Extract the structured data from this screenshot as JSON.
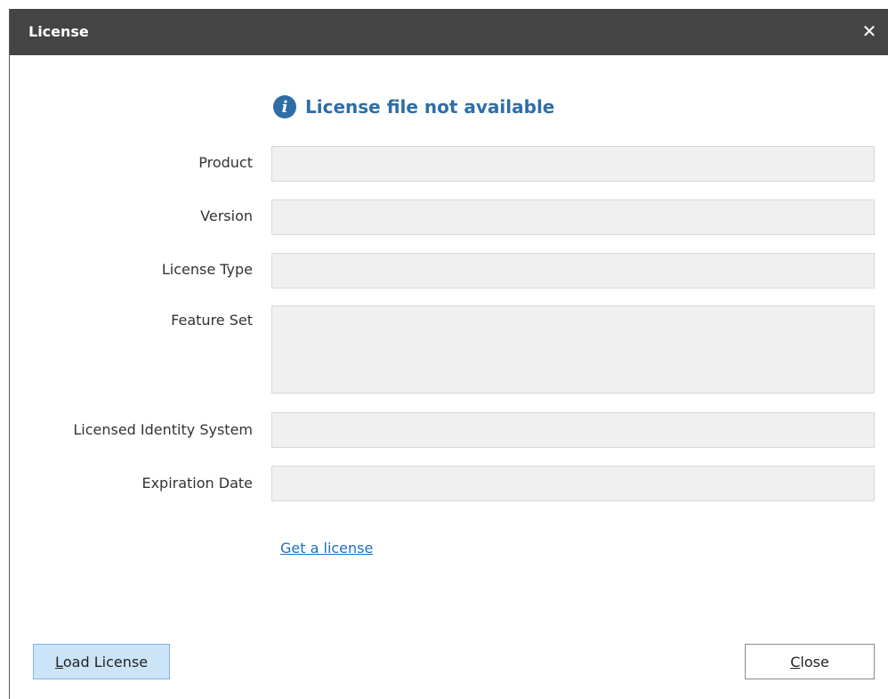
{
  "window": {
    "title": "License",
    "close_glyph": "✕"
  },
  "message": {
    "icon": "info-icon",
    "icon_glyph": "i",
    "text": "License file not available",
    "color": "#2f6ea5"
  },
  "fields": {
    "product": {
      "label": "Product",
      "value": ""
    },
    "version": {
      "label": "Version",
      "value": ""
    },
    "license_type": {
      "label": "License Type",
      "value": ""
    },
    "feature_set": {
      "label": "Feature Set",
      "value": ""
    },
    "licensed_identity_system": {
      "label": "Licensed Identity System",
      "value": ""
    },
    "expiration_date": {
      "label": "Expiration Date",
      "value": ""
    }
  },
  "link": {
    "text": "Get a license"
  },
  "buttons": {
    "load_license": {
      "mnemonic": "L",
      "rest": "oad License"
    },
    "close": {
      "mnemonic": "C",
      "rest": "lose"
    }
  }
}
